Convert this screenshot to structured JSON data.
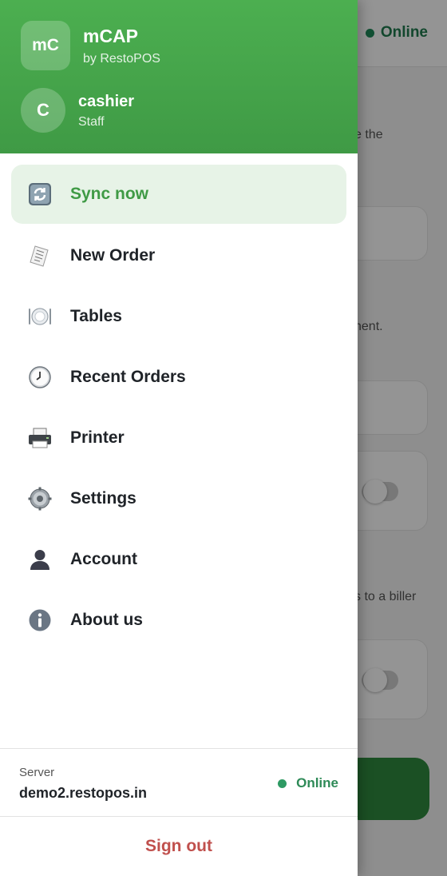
{
  "background": {
    "status": "Online",
    "snippets": [
      "e the",
      "nent.",
      "s to a biller"
    ]
  },
  "drawer": {
    "logo_text": "mC",
    "app_name": "mCAP",
    "app_subtitle": "by RestoPOS",
    "user": {
      "initial": "C",
      "name": "cashier",
      "role": "Staff"
    },
    "menu": [
      {
        "label": "Sync now",
        "icon": "sync-icon",
        "active": true
      },
      {
        "label": "New Order",
        "icon": "receipt-icon",
        "active": false
      },
      {
        "label": "Tables",
        "icon": "plate-icon",
        "active": false
      },
      {
        "label": "Recent Orders",
        "icon": "clock-icon",
        "active": false
      },
      {
        "label": "Printer",
        "icon": "printer-icon",
        "active": false
      },
      {
        "label": "Settings",
        "icon": "gear-icon",
        "active": false
      },
      {
        "label": "Account",
        "icon": "user-icon",
        "active": false
      },
      {
        "label": "About us",
        "icon": "info-icon",
        "active": false
      }
    ],
    "footer": {
      "server_label": "Server",
      "server_value": "demo2.restopos.in",
      "status": "Online",
      "sign_out": "Sign out"
    }
  },
  "colors": {
    "brand_green": "#4caf50",
    "active_bg": "#e7f3e7",
    "online_green": "#2e8a57",
    "sign_out_red": "#c0504d"
  }
}
